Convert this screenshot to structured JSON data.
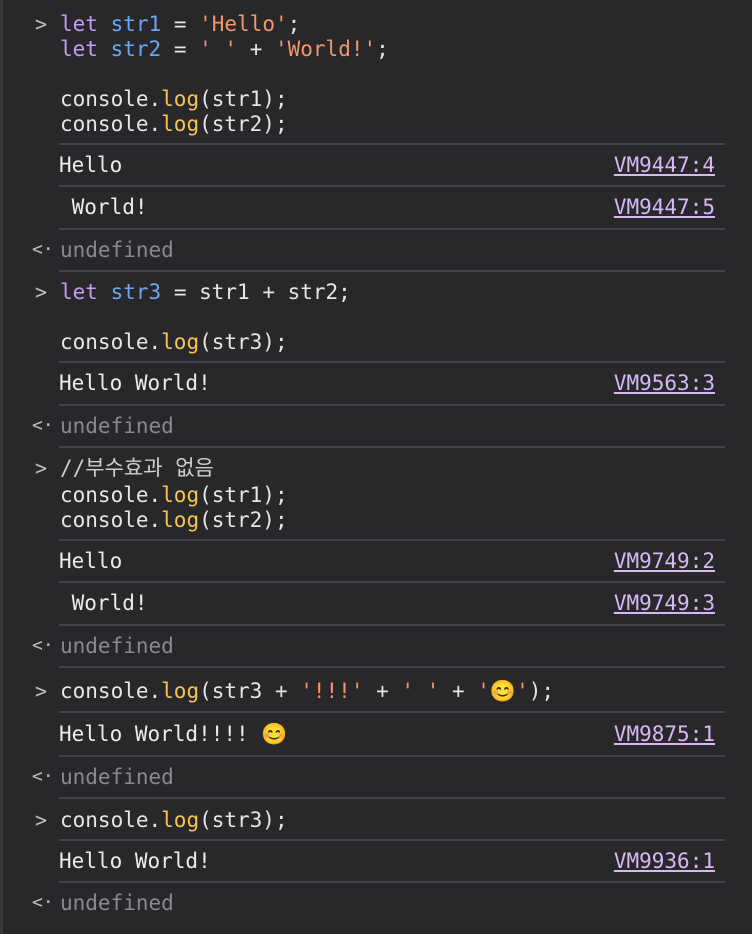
{
  "b1": {
    "l1": {
      "kw": "let",
      "var": "str1",
      "op": " = ",
      "str": "'Hello'",
      "end": ";"
    },
    "l2": {
      "kw": "let",
      "var": "str2",
      "op": " = ",
      "s1": "' '",
      "plus": " + ",
      "s2": "'World!'",
      "end": ";"
    },
    "l3": {
      "obj": "console.",
      "fn": "log",
      "args": "(str1);"
    },
    "l4": {
      "obj": "console.",
      "fn": "log",
      "args": "(str2);"
    },
    "o1": {
      "text": "Hello",
      "src": "VM9447:4"
    },
    "o2": {
      "text": " World!",
      "src": "VM9447:5"
    },
    "ret": "undefined"
  },
  "b2": {
    "l1": {
      "kw": "let",
      "var": "str3",
      "rest": " = str1 + str2;"
    },
    "l2": {
      "obj": "console.",
      "fn": "log",
      "args": "(str3);"
    },
    "o1": {
      "text": "Hello World!",
      "src": "VM9563:3"
    },
    "ret": "undefined"
  },
  "b3": {
    "l1": "//부수효과 없음",
    "l2": {
      "obj": "console.",
      "fn": "log",
      "args": "(str1);"
    },
    "l3": {
      "obj": "console.",
      "fn": "log",
      "args": "(str2);"
    },
    "o1": {
      "text": "Hello",
      "src": "VM9749:2"
    },
    "o2": {
      "text": " World!",
      "src": "VM9749:3"
    },
    "ret": "undefined"
  },
  "b4": {
    "l1": {
      "obj": "console.",
      "fn": "log",
      "a1": "(str3 + ",
      "s1": "'!!!'",
      "p1": " + ",
      "s2": "' '",
      "p2": " + ",
      "s3": "'😊'",
      "end": ");"
    },
    "o1": {
      "text": "Hello World!!!! 😊",
      "src": "VM9875:1"
    },
    "ret": "undefined"
  },
  "b5": {
    "l1": {
      "obj": "console.",
      "fn": "log",
      "args": "(str3);"
    },
    "o1": {
      "text": "Hello World!",
      "src": "VM9936:1"
    },
    "ret": "undefined"
  },
  "icons": {
    "prompt": "chevron-right-icon",
    "result": "return-arrow-icon"
  },
  "colors": {
    "background": "#28282b",
    "keyword": "#c59bf2",
    "variable": "#6ba7f2",
    "string": "#f4956a",
    "function": "#f5c451",
    "link": "#d7b8f5",
    "undefined": "#8a8a8e"
  }
}
